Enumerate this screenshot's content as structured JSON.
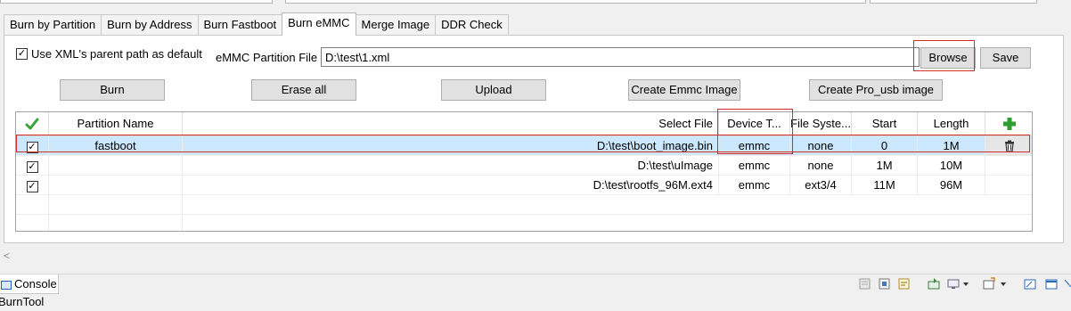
{
  "tabs": [
    "Burn by Partition",
    "Burn by Address",
    "Burn Fastboot",
    "Burn eMMC",
    "Merge Image",
    "DDR Check"
  ],
  "active_tab": "Burn eMMC",
  "options": {
    "use_xml_parent_label": "Use XML's parent path as default",
    "use_xml_parent_checked": true,
    "partition_file_label": "eMMC Partition File",
    "partition_file_value": "D:\\test\\1.xml"
  },
  "buttons": {
    "browse": "Browse",
    "save": "Save",
    "burn": "Burn",
    "erase_all": "Erase all",
    "upload": "Upload",
    "create_emmc": "Create Emmc Image",
    "create_pro_usb": "Create Pro_usb image"
  },
  "table": {
    "headers": [
      "",
      "Partition Name",
      "Select File",
      "Device T...",
      "File Syste...",
      "Start",
      "Length",
      ""
    ],
    "rows": [
      {
        "checked": true,
        "name": "fastboot",
        "file": "D:\\test\\boot_image.bin",
        "device": "emmc",
        "fs": "none",
        "start": "0",
        "length": "1M"
      },
      {
        "checked": true,
        "name": "",
        "file": "D:\\test\\uImage",
        "device": "emmc",
        "fs": "none",
        "start": "1M",
        "length": "10M"
      },
      {
        "checked": true,
        "name": "",
        "file": "D:\\test\\rootfs_96M.ext4",
        "device": "emmc",
        "fs": "ext3/4",
        "start": "11M",
        "length": "96M"
      }
    ]
  },
  "console": {
    "tab_label": "Console",
    "content": "BurnTool"
  },
  "colors": {
    "highlight_red": "#d42b2b",
    "selected_row": "#cce8ff",
    "green_check": "#3aa33a",
    "green_plus": "#2e9e2e"
  }
}
